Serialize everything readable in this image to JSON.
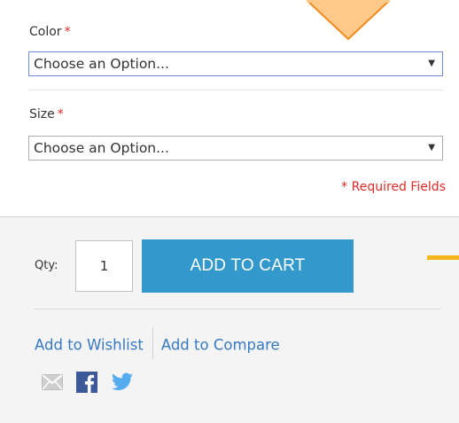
{
  "options": {
    "color": {
      "label": "Color",
      "required_mark": "*",
      "placeholder": "Choose an Option..."
    },
    "size": {
      "label": "Size",
      "required_mark": "*",
      "placeholder": "Choose an Option..."
    },
    "required_note": "* Required Fields"
  },
  "cart": {
    "qty_label": "Qty:",
    "qty_value": "1",
    "add_to_cart_label": "ADD TO CART"
  },
  "links": {
    "wishlist": "Add to Wishlist",
    "compare": "Add to Compare"
  },
  "icons": {
    "email": "email-icon",
    "facebook": "facebook-icon",
    "twitter": "twitter-icon"
  },
  "colors": {
    "accent": "#3399cc",
    "required": "#e02b27",
    "link": "#3779c2",
    "callout": "#f6b51a"
  }
}
